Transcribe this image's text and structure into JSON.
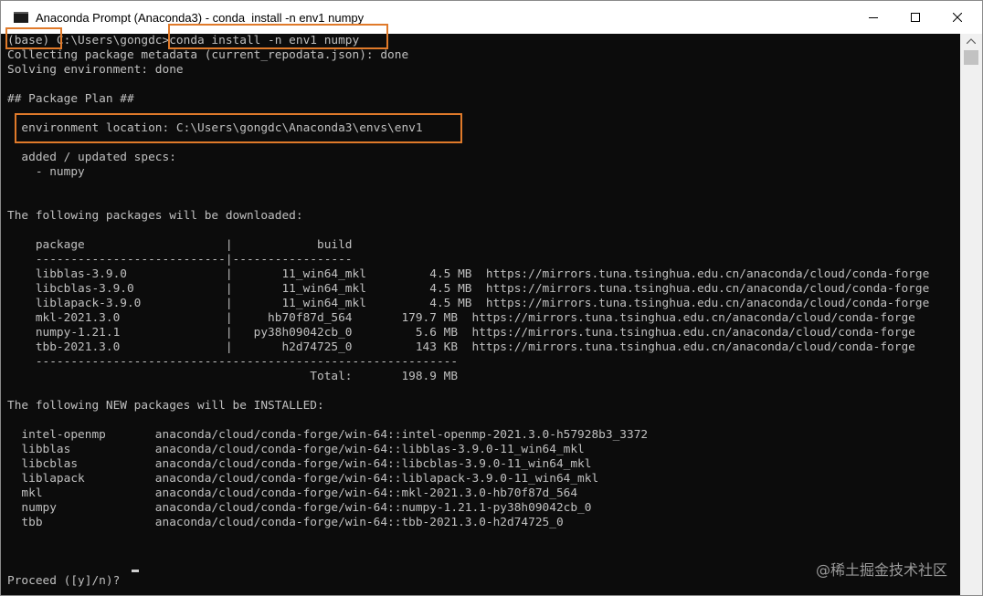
{
  "window": {
    "title": "Anaconda Prompt (Anaconda3) - conda  install -n env1 numpy",
    "icon": "console-icon",
    "controls": [
      "minimize-icon",
      "maximize-icon",
      "close-icon"
    ]
  },
  "colors": {
    "terminal_bg": "#0c0c0c",
    "terminal_fg": "#c0c0c0",
    "highlight_border": "#e07a2a"
  },
  "terminal": {
    "lines": [
      "(base) C:\\Users\\gongdc>conda install -n env1 numpy",
      "Collecting package metadata (current_repodata.json): done",
      "Solving environment: done",
      "",
      "## Package Plan ##",
      "",
      "  environment location: C:\\Users\\gongdc\\Anaconda3\\envs\\env1",
      "",
      "  added / updated specs:",
      "    - numpy",
      "",
      "",
      "The following packages will be downloaded:",
      "",
      "    package                    |            build",
      "    ---------------------------|-----------------",
      "    libblas-3.9.0              |       11_win64_mkl         4.5 MB  https://mirrors.tuna.tsinghua.edu.cn/anaconda/cloud/conda-forge",
      "    libcblas-3.9.0             |       11_win64_mkl         4.5 MB  https://mirrors.tuna.tsinghua.edu.cn/anaconda/cloud/conda-forge",
      "    liblapack-3.9.0            |       11_win64_mkl         4.5 MB  https://mirrors.tuna.tsinghua.edu.cn/anaconda/cloud/conda-forge",
      "    mkl-2021.3.0               |     hb70f87d_564       179.7 MB  https://mirrors.tuna.tsinghua.edu.cn/anaconda/cloud/conda-forge",
      "    numpy-1.21.1               |   py38h09042cb_0         5.6 MB  https://mirrors.tuna.tsinghua.edu.cn/anaconda/cloud/conda-forge",
      "    tbb-2021.3.0               |       h2d74725_0         143 KB  https://mirrors.tuna.tsinghua.edu.cn/anaconda/cloud/conda-forge",
      "    ------------------------------------------------------------",
      "                                           Total:       198.9 MB",
      "",
      "The following NEW packages will be INSTALLED:",
      "",
      "  intel-openmp       anaconda/cloud/conda-forge/win-64::intel-openmp-2021.3.0-h57928b3_3372",
      "  libblas            anaconda/cloud/conda-forge/win-64::libblas-3.9.0-11_win64_mkl",
      "  libcblas           anaconda/cloud/conda-forge/win-64::libcblas-3.9.0-11_win64_mkl",
      "  liblapack          anaconda/cloud/conda-forge/win-64::liblapack-3.9.0-11_win64_mkl",
      "  mkl                anaconda/cloud/conda-forge/win-64::mkl-2021.3.0-hb70f87d_564",
      "  numpy              anaconda/cloud/conda-forge/win-64::numpy-1.21.1-py38h09042cb_0",
      "  tbb                anaconda/cloud/conda-forge/win-64::tbb-2021.3.0-h2d74725_0",
      "",
      "",
      "",
      "Proceed ([y]/n)? "
    ]
  },
  "watermark": "@稀土掘金技术社区"
}
